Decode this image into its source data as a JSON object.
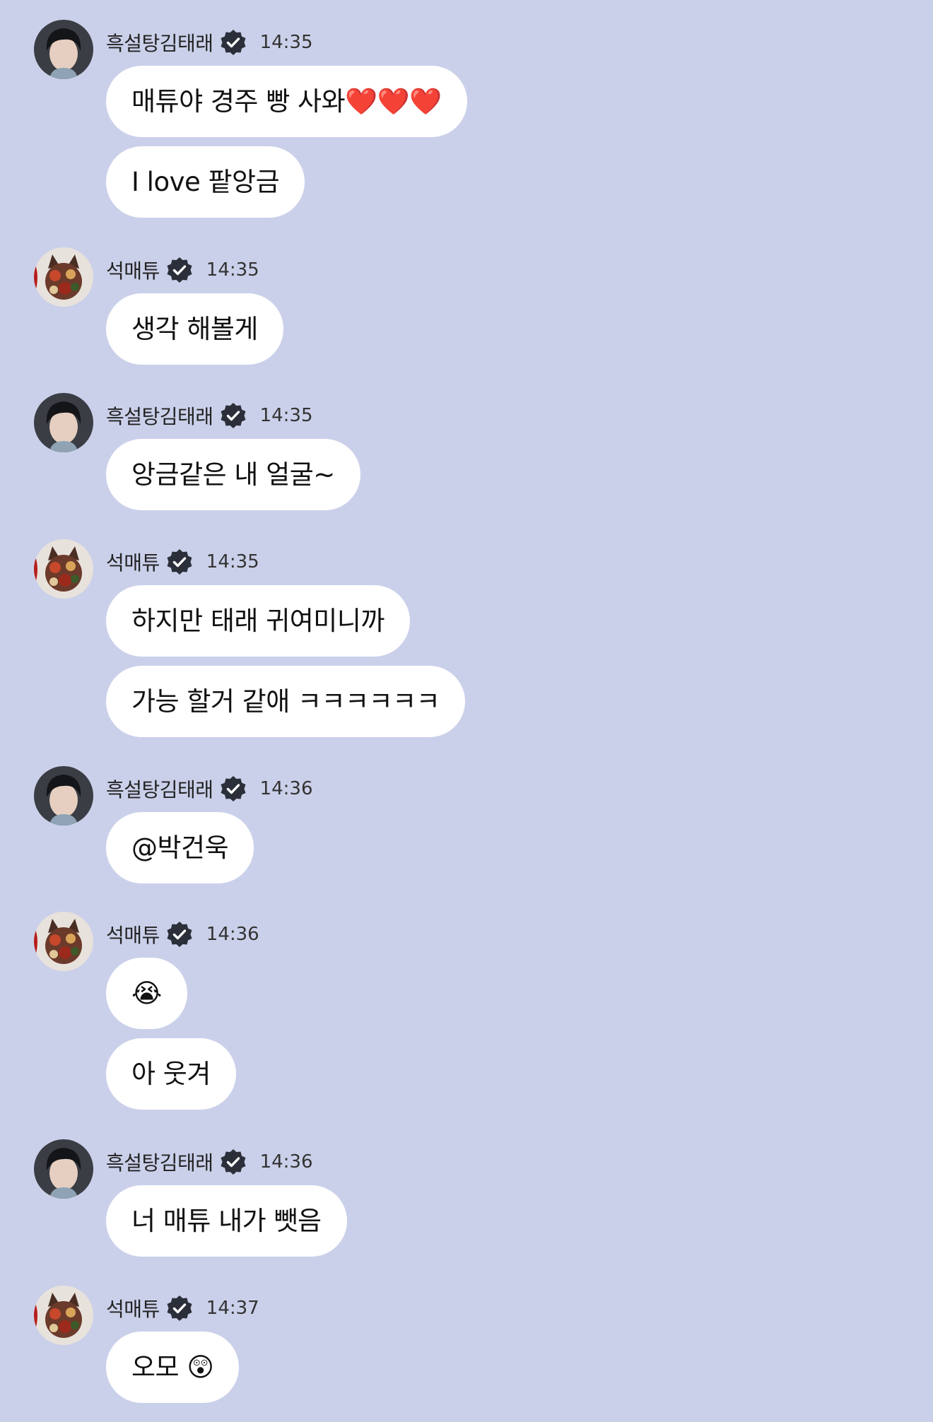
{
  "users": {
    "taerae": {
      "name": "흑설탕김태래",
      "avatar_icon": "profile-photo-dark-hair"
    },
    "matthew": {
      "name": "석매튜",
      "avatar_icon": "profile-photo-flower-cat"
    }
  },
  "colors": {
    "background": "#cbd0ea",
    "bubble": "#ffffff",
    "verified_badge": "#2b2f3a"
  },
  "messages": [
    {
      "sender": "흑설탕김태래",
      "time": "14:35",
      "bubbles": [
        "매튜야 경주 빵 사와❤️❤️❤️",
        "I love 팥앙금"
      ]
    },
    {
      "sender": "석매튜",
      "time": "14:35",
      "bubbles": [
        "생각 해볼게"
      ]
    },
    {
      "sender": "흑설탕김태래",
      "time": "14:35",
      "bubbles": [
        "앙금같은 내 얼굴~"
      ]
    },
    {
      "sender": "석매튜",
      "time": "14:35",
      "bubbles": [
        "하지만 태래 귀여미니까",
        "가능 할거 같애 ㅋㅋㅋㅋㅋㅋ"
      ]
    },
    {
      "sender": "흑설탕김태래",
      "time": "14:36",
      "bubbles": [
        "@박건욱"
      ]
    },
    {
      "sender": "석매튜",
      "time": "14:36",
      "bubbles": [
        "😭",
        "아 웃겨"
      ]
    },
    {
      "sender": "흑설탕김태래",
      "time": "14:36",
      "bubbles": [
        "너 매튜 내가 뺏음"
      ]
    },
    {
      "sender": "석매튜",
      "time": "14:37",
      "bubbles": [
        "오모 😲"
      ]
    }
  ]
}
